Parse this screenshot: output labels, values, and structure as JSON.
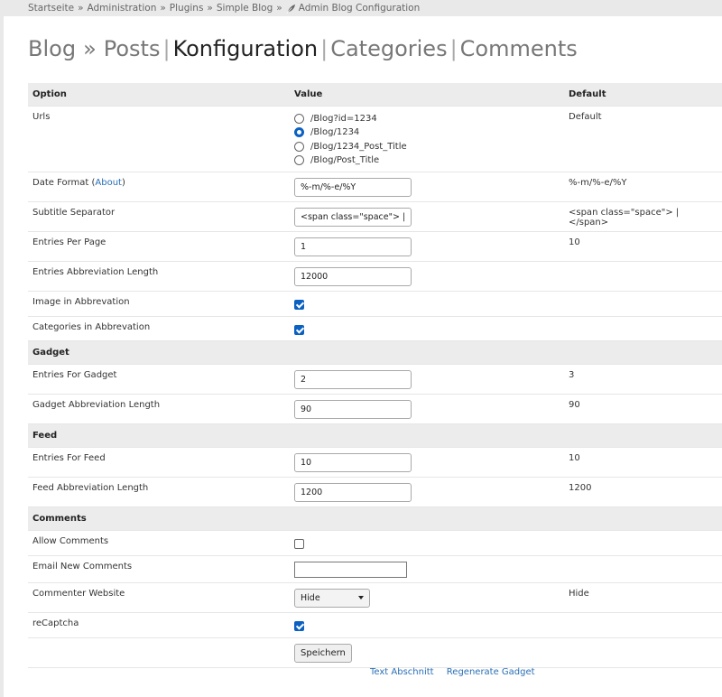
{
  "breadcrumb": {
    "items": [
      "Startseite",
      "Administration",
      "Plugins",
      "Simple Blog"
    ],
    "current": "Admin Blog Configuration",
    "separator": "»"
  },
  "title": {
    "blog": "Blog",
    "raquo": "»",
    "tabs": [
      "Posts",
      "Konfiguration",
      "Categories",
      "Comments"
    ],
    "active_tab": "Konfiguration"
  },
  "table": {
    "headers": {
      "option": "Option",
      "value": "Value",
      "default": "Default"
    },
    "urls": {
      "label": "Urls",
      "options": [
        "/Blog?id=1234",
        "/Blog/1234",
        "/Blog/1234_Post_Title",
        "/Blog/Post_Title"
      ],
      "selected_index": 1,
      "default": "Default"
    },
    "date_format": {
      "label_prefix": "Date Format (",
      "link": "About",
      "label_suffix": ")",
      "value": "%-m/%-e/%Y",
      "default": "%-m/%-e/%Y"
    },
    "subtitle_separator": {
      "label": "Subtitle Separator",
      "value": "<span class=\"space\"> | </span>",
      "default": "<span class=\"space\"> | </span>"
    },
    "entries_per_page": {
      "label": "Entries Per Page",
      "value": "1",
      "default": "10"
    },
    "entries_abbrev_length": {
      "label": "Entries Abbreviation Length",
      "value": "12000",
      "default": ""
    },
    "image_in_abbrev": {
      "label": "Image in Abbrevation",
      "checked": true
    },
    "categories_in_abbrev": {
      "label": "Categories in Abbrevation",
      "checked": true
    },
    "gadget_section": "Gadget",
    "entries_for_gadget": {
      "label": "Entries For Gadget",
      "value": "2",
      "default": "3"
    },
    "gadget_abbrev_length": {
      "label": "Gadget Abbreviation Length",
      "value": "90",
      "default": "90"
    },
    "feed_section": "Feed",
    "entries_for_feed": {
      "label": "Entries For Feed",
      "value": "10",
      "default": "10"
    },
    "feed_abbrev_length": {
      "label": "Feed Abbreviation Length",
      "value": "1200",
      "default": "1200"
    },
    "comments_section": "Comments",
    "allow_comments": {
      "label": "Allow Comments",
      "checked": false
    },
    "email_new_comments": {
      "label": "Email New Comments",
      "value": ""
    },
    "commenter_website": {
      "label": "Commenter Website",
      "value": "Hide",
      "default": "Hide"
    },
    "recaptcha": {
      "label": "reCaptcha",
      "checked": true
    },
    "save_button": "Speichern"
  },
  "footer": {
    "links": [
      "Text Abschnitt",
      "Regenerate Gadget"
    ]
  },
  "colors": {
    "accent": "#0b61c2",
    "link": "#2a6fb5",
    "header_bg": "#ececec",
    "page_bg": "#e9e9e9"
  },
  "icons": {
    "breadcrumb_current": "leaf-icon",
    "select_caret": "chevron-down-icon"
  }
}
